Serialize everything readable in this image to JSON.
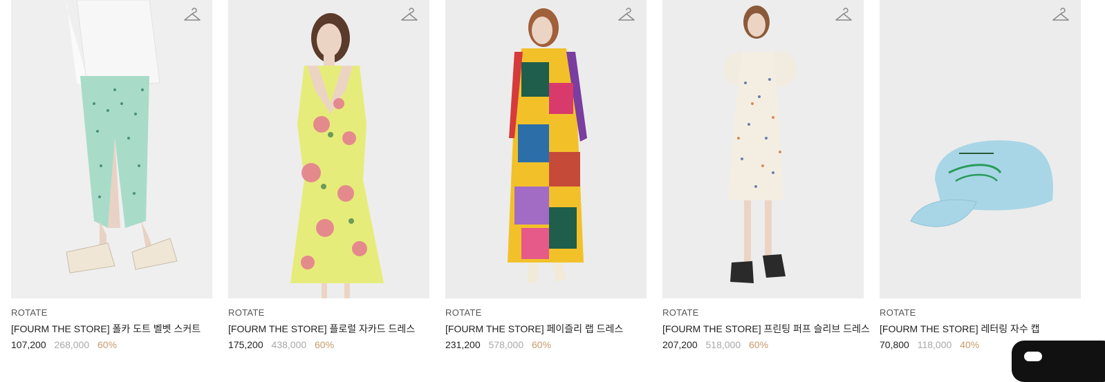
{
  "products": [
    {
      "brand": "ROTATE",
      "name": "[FOURM THE STORE] 폴카 도트 벨벳 스커트",
      "price": "107,200",
      "original_price": "268,000",
      "discount": "60%",
      "image": "mint-velvet-polka-dot-skirt"
    },
    {
      "brand": "ROTATE",
      "name": "[FOURM THE STORE] 플로럴 자카드 드레스",
      "price": "175,200",
      "original_price": "438,000",
      "discount": "60%",
      "image": "yellow-floral-jacquard-dress"
    },
    {
      "brand": "ROTATE",
      "name": "[FOURM THE STORE] 페이즐리 랩 드레스",
      "price": "231,200",
      "original_price": "578,000",
      "discount": "60%",
      "image": "multicolor-paisley-wrap-dress"
    },
    {
      "brand": "ROTATE",
      "name": "[FOURM THE STORE] 프린팅 퍼프 슬리브 드레스",
      "price": "207,200",
      "original_price": "518,000",
      "discount": "60%",
      "image": "printed-puff-sleeve-dress"
    },
    {
      "brand": "ROTATE",
      "name": "[FOURM THE STORE] 레터링 자수 캡",
      "price": "70,800",
      "original_price": "118,000",
      "discount": "40%",
      "image": "light-blue-embroidered-cap"
    }
  ],
  "icons": {
    "wishlist": "hanger-icon"
  },
  "colors": {
    "discount": "#c79a6c",
    "original_price": "#a8a8a8",
    "thumb_bg": "#ececec"
  }
}
